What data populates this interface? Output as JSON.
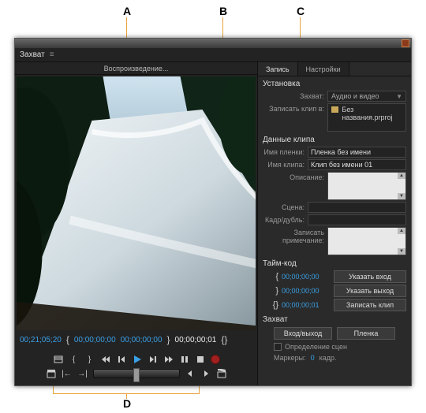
{
  "callouts": {
    "A": "A",
    "B": "B",
    "C": "C",
    "D": "D"
  },
  "window": {
    "panel_title": "Захват",
    "status": "Воспроизведение...",
    "timecode": {
      "device": "00;21;05;20",
      "in": "00;00;00;00",
      "out": "00;00;00;00",
      "dur": "00;00;00;01"
    }
  },
  "right": {
    "tabs": {
      "record": "Запись",
      "settings": "Настройки"
    },
    "setup": {
      "heading": "Установка",
      "capture_label": "Захват:",
      "capture_value": "Аудио и видео",
      "logto_label": "Записать клип в:",
      "project_name": "Без названия.prproj"
    },
    "clipdata": {
      "heading": "Данные клипа",
      "tape_label": "Имя пленки:",
      "tape_value": "Пленка без имени",
      "clip_label": "Имя клипа:",
      "clip_value": "Клип без имени 01",
      "desc_label": "Описание:",
      "scene_label": "Сцена:",
      "shot_label": "Кадр/дубль:",
      "lognote_label": "Записать примечание:"
    },
    "timecode": {
      "heading": "Тайм-код",
      "in_val": "00;00;00;00",
      "out_val": "00;00;00;00",
      "dur_val": "00;00;00;01",
      "set_in": "Указать вход",
      "set_out": "Указать выход",
      "log_clip": "Записать клип"
    },
    "capture": {
      "heading": "Захват",
      "inout": "Вход/выход",
      "tape": "Пленка",
      "scene_detect": "Определение сцен",
      "markers_label": "Маркеры:",
      "markers_count": "0",
      "markers_unit": "кадр."
    }
  }
}
